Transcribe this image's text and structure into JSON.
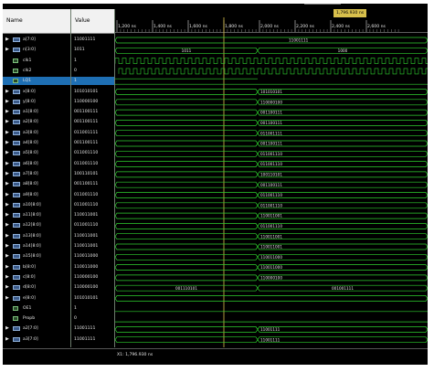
{
  "header": {
    "name_label": "Name",
    "value_label": "Value"
  },
  "cursor_label": "1,796.930 ns",
  "status_text": "X1: 1,796.930 ns",
  "time_ticks": [
    "1,200 ns",
    "1,400 ns",
    "1,600 ns",
    "1,800 ns",
    "2,000 ns",
    "2,200 ns",
    "2,400 ns",
    "2,600 ns"
  ],
  "signals": [
    {
      "name": "a[7:0]",
      "value": "11001111",
      "bus": true
    },
    {
      "name": "n[3:0]",
      "value": "1011",
      "bus": true
    },
    {
      "name": "clk1",
      "value": "1",
      "bus": false
    },
    {
      "name": "clk2",
      "value": "0",
      "bus": false
    },
    {
      "name": "LQ1",
      "value": "1",
      "bus": false,
      "selected": true
    },
    {
      "name": "x[8:0]",
      "value": "101010101",
      "bus": true
    },
    {
      "name": "y[8:0]",
      "value": "110000100",
      "bus": true
    },
    {
      "name": "a1[8:0]",
      "value": "001100111",
      "bus": true
    },
    {
      "name": "a2[8:0]",
      "value": "001100111",
      "bus": true
    },
    {
      "name": "a3[8:0]",
      "value": "011001111",
      "bus": true
    },
    {
      "name": "a4[8:0]",
      "value": "001100111",
      "bus": true
    },
    {
      "name": "a5[8:0]",
      "value": "011001110",
      "bus": true
    },
    {
      "name": "a6[8:0]",
      "value": "011001110",
      "bus": true
    },
    {
      "name": "a7[8:0]",
      "value": "100110101",
      "bus": true
    },
    {
      "name": "a8[8:0]",
      "value": "001100111",
      "bus": true
    },
    {
      "name": "a9[8:0]",
      "value": "011001110",
      "bus": true
    },
    {
      "name": "a10[8:0]",
      "value": "011001110",
      "bus": true
    },
    {
      "name": "a11[8:0]",
      "value": "110011001",
      "bus": true
    },
    {
      "name": "a12[8:0]",
      "value": "011001110",
      "bus": true
    },
    {
      "name": "a13[8:0]",
      "value": "110011001",
      "bus": true
    },
    {
      "name": "a14[8:0]",
      "value": "110011001",
      "bus": true
    },
    {
      "name": "a15[8:0]",
      "value": "110011000",
      "bus": true
    },
    {
      "name": "b[8:0]",
      "value": "110011000",
      "bus": true
    },
    {
      "name": "c[8:0]",
      "value": "110000100",
      "bus": true
    },
    {
      "name": "d[8:0]",
      "value": "110000100",
      "bus": true
    },
    {
      "name": "e[8:0]",
      "value": "101010101",
      "bus": true
    },
    {
      "name": "OE1",
      "value": "1",
      "bus": false
    },
    {
      "name": "Propb",
      "value": "0",
      "bus": false
    },
    {
      "name": "a2[7:0]",
      "value": "11001111",
      "bus": true
    },
    {
      "name": "a3[7:0]",
      "value": "11001111",
      "bus": true
    }
  ],
  "bus_labels": {
    "a7_0": "11001111",
    "n_left": "1011",
    "n_right": "1000",
    "x": "101010101",
    "y": "110000100",
    "a1": "001100111",
    "a2": "001100111",
    "a3": "011001111",
    "a4": "001100111",
    "a5": "011001110",
    "a6": "011001110",
    "a7": "100110101",
    "a8": "001100111",
    "a9": "011001110",
    "a10": "011001110",
    "a11": "110011001",
    "a12": "011001110",
    "a13": "110011001",
    "a14": "110011001",
    "a15": "110011000",
    "b": "110011000",
    "c": "110000100",
    "e_left": "001110101",
    "e_right": "001001111",
    "a2_7_0": "11001111",
    "a3_7_0": "11001111"
  },
  "colors": {
    "wave": "#2fd12f",
    "cursor": "#d8c04c",
    "grid": "#3a3a3a",
    "bus_text": "#e6e6e6"
  }
}
